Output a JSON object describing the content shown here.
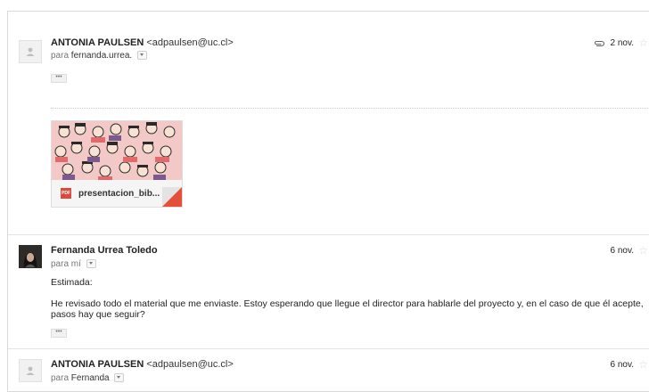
{
  "messages": [
    {
      "sender_name": "ANTONIA PAULSEN",
      "sender_email": "<adpaulsen@uc.cl>",
      "to_prefix": "para",
      "to_name": "fernanda.urrea.",
      "date": "2 nov.",
      "has_attachment_icon": true,
      "attachment": {
        "filename": "presentacion_bib...",
        "type": "pdf",
        "type_label": "PDF"
      }
    },
    {
      "sender_name": "Fernanda Urrea Toledo",
      "to_prefix": "para",
      "to_name": "mí",
      "date": "6 nov.",
      "greeting": "Estimada:",
      "body_line1": "He revisado todo el material que me enviaste. Estoy esperando que llegue el director para hablarle del proyecto y, en el caso de que él acepte,",
      "body_line2": "pasos hay que seguir?"
    },
    {
      "sender_name": "ANTONIA PAULSEN",
      "sender_email": "<adpaulsen@uc.cl>",
      "to_prefix": "para",
      "to_name": "Fernanda",
      "date": "6 nov."
    }
  ],
  "ellipsis_label": "•••",
  "star_glyph": "☆",
  "colors": {
    "pdf_red": "#dc4a3d",
    "thumb_bg": "#f2c9c7"
  }
}
